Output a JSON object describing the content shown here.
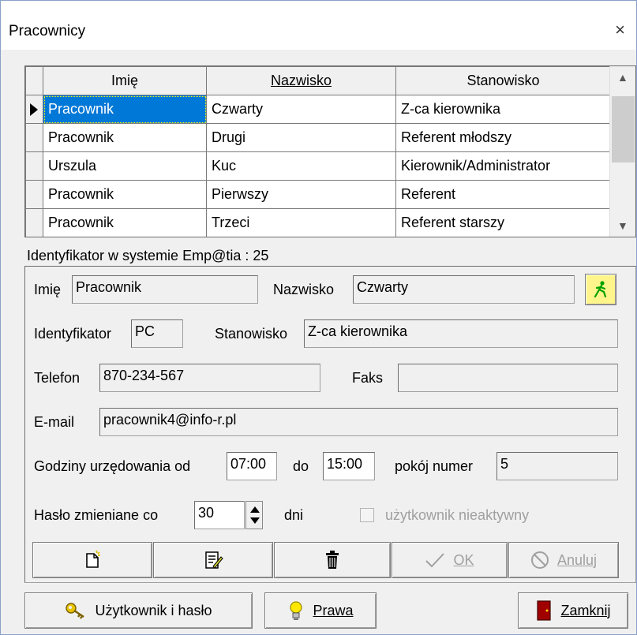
{
  "window": {
    "title": "Pracownicy",
    "close_glyph": "×"
  },
  "grid": {
    "headers": [
      "Imię",
      "Nazwisko",
      "Stanowisko"
    ],
    "rows": [
      [
        "Pracownik",
        "Czwarty",
        "Z-ca kierownika"
      ],
      [
        "Pracownik",
        "Drugi",
        "Referent młodszy"
      ],
      [
        "Urszula",
        "Kuc",
        "Kierownik/Administrator"
      ],
      [
        "Pracownik",
        "Pierwszy",
        "Referent"
      ],
      [
        "Pracownik",
        "Trzeci",
        "Referent starszy"
      ]
    ],
    "selected_row": 0
  },
  "id_line": "Identyfikator w systemie Emp@tia : 25",
  "form": {
    "imie_label": "Imię",
    "imie_value": "Pracownik",
    "nazwisko_label": "Nazwisko",
    "nazwisko_value": "Czwarty",
    "identyfikator_label": "Identyfikator",
    "identyfikator_value": "PC",
    "stanowisko_label": "Stanowisko",
    "stanowisko_value": "Z-ca kierownika",
    "telefon_label": "Telefon",
    "telefon_value": "870-234-567",
    "faks_label": "Faks",
    "faks_value": "",
    "email_label": "E-mail",
    "email_value": "pracownik4@info-r.pl",
    "godziny_label": "Godziny urzędowania od",
    "od_value": "07:00",
    "do_label": "do",
    "do_value": "15:00",
    "pokoj_label": "pokój numer",
    "pokoj_value": "5",
    "haslo_label": "Hasło zmieniane co",
    "haslo_value": "30",
    "dni_label": "dni",
    "nieaktywny_label": "użytkownik nieaktywny"
  },
  "toolbar": {
    "new_icon": "new-document-icon",
    "edit_icon": "edit-document-icon",
    "delete_icon": "trash-icon",
    "ok_label": "OK",
    "cancel_label": "Anuluj"
  },
  "bottom": {
    "user_pass_label": "Użytkownik i hasło",
    "rights_label": "Prawa",
    "close_label": "Zamknij"
  },
  "colors": {
    "selection": "#0078d7",
    "panel": "#f0f0f0",
    "disabled_text": "#a0a0a0"
  }
}
